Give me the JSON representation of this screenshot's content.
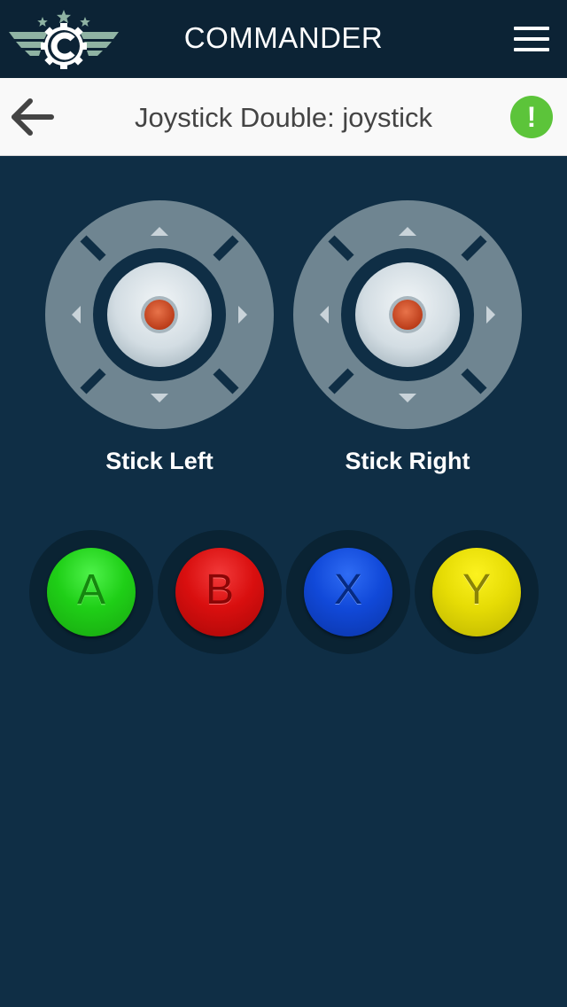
{
  "app": {
    "title": "COMMANDER"
  },
  "header": {
    "page_title": "Joystick Double: joystick",
    "status_symbol": "!"
  },
  "joysticks": [
    {
      "label": "Stick Left"
    },
    {
      "label": "Stick Right"
    }
  ],
  "buttons": [
    {
      "letter": "A",
      "color": "#1fcf17"
    },
    {
      "letter": "B",
      "color": "#d90f0f"
    },
    {
      "letter": "X",
      "color": "#1149d9"
    },
    {
      "letter": "Y",
      "color": "#e6dc05"
    }
  ],
  "icons": {
    "logo": "commander-winged-c-logo-icon",
    "menu": "hamburger-menu-icon",
    "back": "arrow-left-icon",
    "status": "exclamation-circle-icon",
    "joystick_arrows": [
      "triangle-up-icon",
      "triangle-down-icon",
      "triangle-left-icon",
      "triangle-right-icon"
    ]
  },
  "colors": {
    "background": "#0f2e45",
    "appbar": "#0c2335",
    "status_ok": "#5cc43a",
    "joystick_ring": "#6f8591",
    "joystick_knob": "#d6e0e6",
    "joystick_nub": "#d6532a"
  }
}
